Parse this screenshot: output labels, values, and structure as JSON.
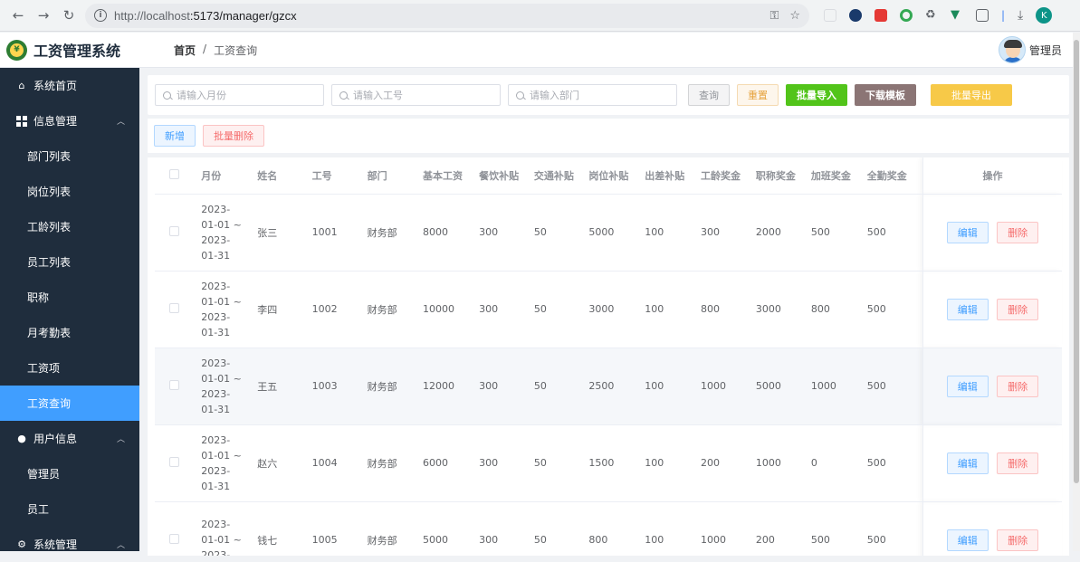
{
  "browser": {
    "url_host": "http://localhost",
    "url_path": ":5173/manager/gzcx"
  },
  "header": {
    "app_title": "工资管理系统",
    "breadcrumb_home": "首页",
    "breadcrumb_sep": "/",
    "breadcrumb_current": "工资查询",
    "username": "管理员"
  },
  "sidebar": {
    "home": "系统首页",
    "info_group": "信息管理",
    "info_items": [
      "部门列表",
      "岗位列表",
      "工龄列表",
      "员工列表",
      "职称",
      "月考勤表",
      "工资项",
      "工资查询"
    ],
    "user_group": "用户信息",
    "user_items": [
      "管理员",
      "员工"
    ],
    "system_group": "系统管理"
  },
  "search": {
    "month_placeholder": "请输入月份",
    "id_placeholder": "请输入工号",
    "dept_placeholder": "请输入部门",
    "query": "查询",
    "reset": "重置",
    "bulk_import": "批量导入",
    "download_template": "下载模板",
    "bulk_export": "批量导出"
  },
  "actions": {
    "add": "新增",
    "bulk_delete": "批量删除"
  },
  "table": {
    "columns": [
      "月份",
      "姓名",
      "工号",
      "部门",
      "基本工资",
      "餐饮补贴",
      "交通补贴",
      "岗位补贴",
      "出差补贴",
      "工龄奖金",
      "职称奖金",
      "加班奖金",
      "全勤奖金",
      "操作"
    ],
    "edit": "编辑",
    "delete": "删除",
    "rows": [
      {
        "month": [
          "2023-",
          "01-01 ~",
          "2023-",
          "01-31"
        ],
        "name": "张三",
        "id": "1001",
        "dept": "财务部",
        "base": "8000",
        "meal": "300",
        "traffic": "50",
        "post": "5000",
        "trip": "100",
        "seniority": "300",
        "title": "2000",
        "overtime": "500",
        "attendance": "500"
      },
      {
        "month": [
          "2023-",
          "01-01 ~",
          "2023-",
          "01-31"
        ],
        "name": "李四",
        "id": "1002",
        "dept": "财务部",
        "base": "10000",
        "meal": "300",
        "traffic": "50",
        "post": "3000",
        "trip": "100",
        "seniority": "800",
        "title": "3000",
        "overtime": "800",
        "attendance": "500"
      },
      {
        "month": [
          "2023-",
          "01-01 ~",
          "2023-",
          "01-31"
        ],
        "name": "王五",
        "id": "1003",
        "dept": "财务部",
        "base": "12000",
        "meal": "300",
        "traffic": "50",
        "post": "2500",
        "trip": "100",
        "seniority": "1000",
        "title": "5000",
        "overtime": "1000",
        "attendance": "500"
      },
      {
        "month": [
          "2023-",
          "01-01 ~",
          "2023-",
          "01-31"
        ],
        "name": "赵六",
        "id": "1004",
        "dept": "财务部",
        "base": "6000",
        "meal": "300",
        "traffic": "50",
        "post": "1500",
        "trip": "100",
        "seniority": "200",
        "title": "1000",
        "overtime": "0",
        "attendance": "500"
      },
      {
        "month": [
          "2023-",
          "01-01 ~",
          "2023-"
        ],
        "name": "钱七",
        "id": "1005",
        "dept": "财务部",
        "base": "5000",
        "meal": "300",
        "traffic": "50",
        "post": "800",
        "trip": "100",
        "seniority": "1000",
        "title": "200",
        "overtime": "500",
        "attendance": "500"
      }
    ]
  }
}
